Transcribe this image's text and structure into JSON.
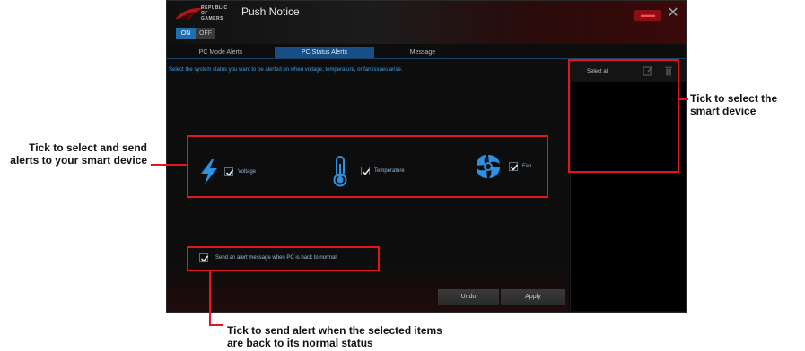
{
  "window": {
    "logo_text_line1": "REPUBLIC OF",
    "logo_text_line2": "GAMERS",
    "title": "Push Notice",
    "close_label": "✕",
    "toggle": {
      "on_label": "ON",
      "off_label": "OFF",
      "selected": "ON"
    }
  },
  "tabs": [
    {
      "label": "PC Mode Alerts",
      "active": false
    },
    {
      "label": "PC Status Alerts",
      "active": true
    },
    {
      "label": "Message",
      "active": false
    }
  ],
  "content": {
    "instruction": "Select the system status you want to be alerted on when voltage, temperature, or fan issues arise.",
    "items": [
      {
        "label": "Voltage",
        "checked": true,
        "icon": "lightning-icon"
      },
      {
        "label": "Temperature",
        "checked": true,
        "icon": "thermometer-icon"
      },
      {
        "label": "Fan",
        "checked": true,
        "icon": "fan-icon"
      }
    ],
    "back_to_normal": {
      "label": "Send an alert message when PC is back to normal.",
      "checked": true
    },
    "buttons": {
      "undo": "Undo",
      "apply": "Apply"
    }
  },
  "device_panel": {
    "select_all": "Select all",
    "icons": [
      "edit-icon",
      "trash-icon"
    ]
  },
  "annotations": {
    "left": "Tick to select and send alerts to your smart device",
    "right": "Tick to select the smart device",
    "bottom": "Tick to send alert when the selected items are back to its normal status"
  },
  "colors": {
    "accent_blue": "#3c9fe6",
    "tab_active": "#174e86",
    "annotation_red": "#e2161c",
    "toggle_on": "#1f6fb3"
  }
}
